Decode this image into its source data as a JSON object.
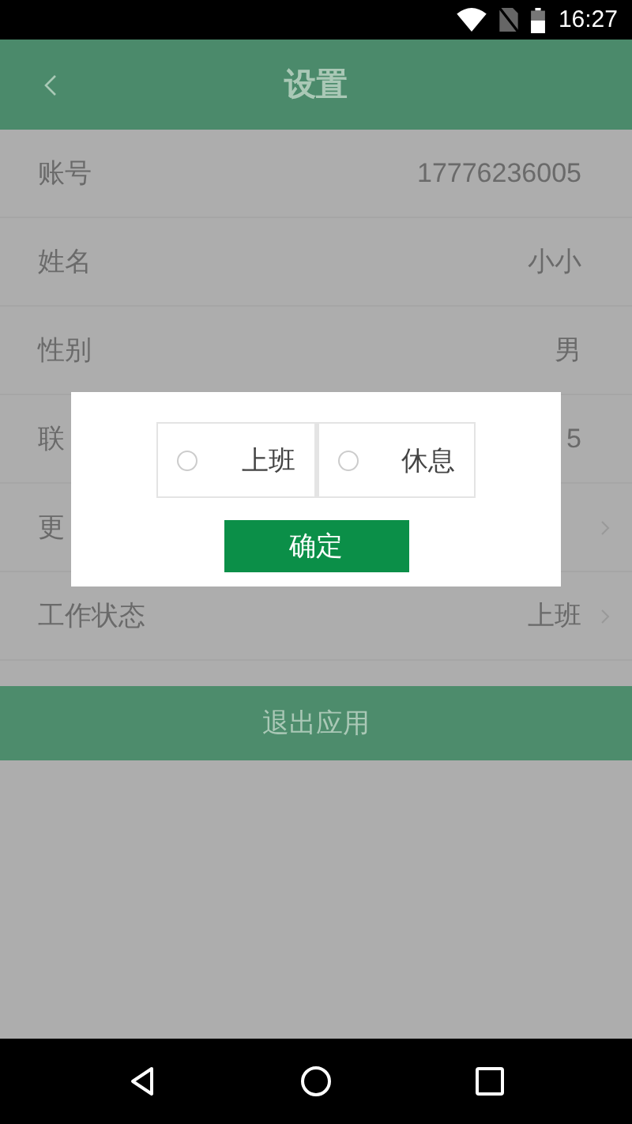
{
  "status_bar": {
    "time": "16:27"
  },
  "header": {
    "title": "设置"
  },
  "rows": [
    {
      "label": "账号",
      "value": "17776236005",
      "arrow": false
    },
    {
      "label": "姓名",
      "value": "小小",
      "arrow": false
    },
    {
      "label": "性别",
      "value": "男",
      "arrow": false
    },
    {
      "label": "联",
      "value": "5",
      "arrow": false
    },
    {
      "label": "更",
      "arrow": true
    },
    {
      "label": "工作状态",
      "value": "上班",
      "arrow": true
    }
  ],
  "exit_button": "退出应用",
  "dialog": {
    "options": [
      {
        "label": "上班",
        "selected": false
      },
      {
        "label": "休息",
        "selected": false
      }
    ],
    "confirm": "确定"
  }
}
